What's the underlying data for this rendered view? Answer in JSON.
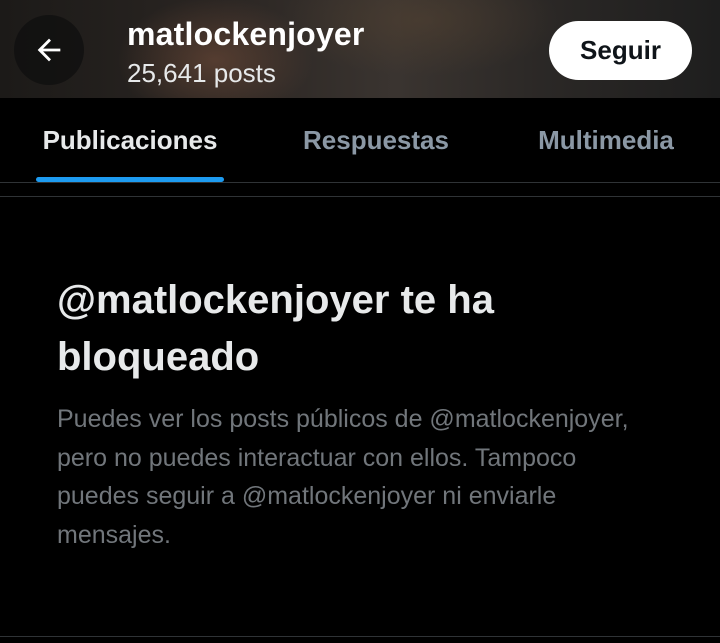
{
  "header": {
    "back_icon": "arrow-left-icon",
    "username": "matlockenjoyer",
    "post_count": "25,641 posts",
    "follow_label": "Seguir"
  },
  "tabs": [
    {
      "label": "Publicaciones",
      "active": true
    },
    {
      "label": "Respuestas",
      "active": false
    },
    {
      "label": "Multimedia",
      "active": false
    }
  ],
  "blocked": {
    "title": "@matlockenjoyer te ha bloqueado",
    "description": "Puedes ver los posts públicos de @matlockenjoyer, pero no puedes interactuar con ellos. Tampoco puedes seguir a @matlockenjoyer ni enviarle mensajes."
  },
  "colors": {
    "background": "#000000",
    "accent": "#1d9bf0",
    "text_primary": "#e7e9ea",
    "text_secondary": "#71767b",
    "tab_inactive": "#8b98a5"
  }
}
